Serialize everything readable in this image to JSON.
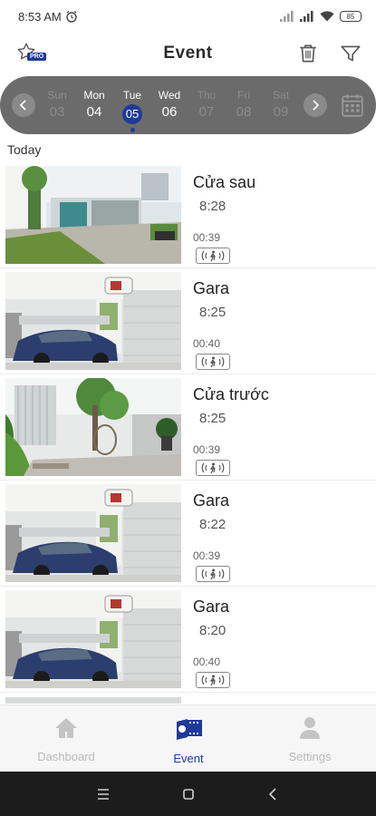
{
  "status_bar": {
    "time": "8:53 AM",
    "battery": "85",
    "icons": [
      "alarm-icon",
      "signal-icon",
      "signal-icon",
      "wifi-icon",
      "battery-icon"
    ]
  },
  "header": {
    "title": "Event",
    "pro_badge": "PRO",
    "icons": [
      "star-pro-icon",
      "trash-icon",
      "filter-icon"
    ]
  },
  "date_strip": {
    "days": [
      {
        "name": "Sun",
        "num": "03"
      },
      {
        "name": "Mon",
        "num": "04"
      },
      {
        "name": "Tue",
        "num": "05"
      },
      {
        "name": "Wed",
        "num": "06"
      },
      {
        "name": "Thu",
        "num": "07"
      },
      {
        "name": "Fri",
        "num": "08"
      },
      {
        "name": "Sat",
        "num": "09"
      }
    ],
    "selected_day": "Tue 05",
    "icons": [
      "chevron-left-icon",
      "chevron-right-icon",
      "calendar-icon"
    ]
  },
  "section_label": "Today",
  "events": [
    {
      "name": "Cửa sau",
      "time": "8:28",
      "duration": "00:39"
    },
    {
      "name": "Gara",
      "time": "8:25",
      "duration": "00:40"
    },
    {
      "name": "Cửa trước",
      "time": "8:25",
      "duration": "00:39"
    },
    {
      "name": "Gara",
      "time": "8:22",
      "duration": "00:39"
    },
    {
      "name": "Gara",
      "time": "8:20",
      "duration": "00:40"
    }
  ],
  "bottom_nav": [
    {
      "label": "Dashboard",
      "icon": "home-icon",
      "active": false
    },
    {
      "label": "Event",
      "icon": "event-film-icon",
      "active": true
    },
    {
      "label": "Settings",
      "icon": "person-icon",
      "active": false
    }
  ],
  "system_nav": {
    "icons": [
      "menu-icon",
      "home-square-icon",
      "back-icon"
    ]
  },
  "colors": {
    "accent": "#1e3a9a",
    "strip": "#6b6b6b",
    "inactive": "#b9b9b9"
  }
}
